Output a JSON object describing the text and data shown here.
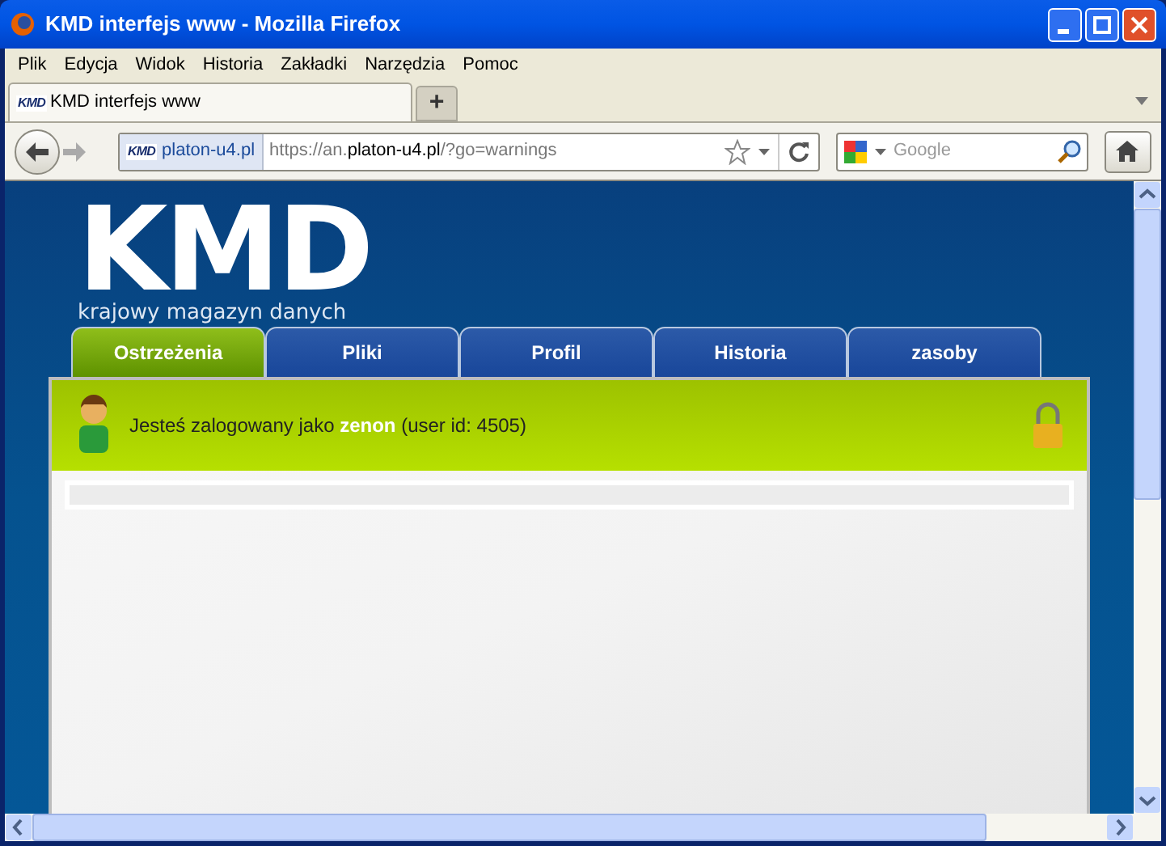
{
  "window": {
    "title": "KMD interfejs www - Mozilla Firefox"
  },
  "menu": [
    "Plik",
    "Edycja",
    "Widok",
    "Historia",
    "Zakładki",
    "Narzędzia",
    "Pomoc"
  ],
  "browser_tabs": [
    {
      "label": "KMD interfejs www",
      "favicon": "KMD",
      "selected": true
    }
  ],
  "new_tab": "+",
  "address": {
    "site": "platon-u4.pl",
    "favicon": "KMD",
    "url_prefix": "https://an.",
    "url_domain": "platon-u4.pl",
    "url_suffix": "/?go=warnings"
  },
  "search": {
    "placeholder": "Google"
  },
  "page": {
    "logo": "KMD",
    "tagline": "krajowy magazyn danych",
    "nav": [
      {
        "label": "Ostrzeżenia",
        "selected": true
      },
      {
        "label": "Pliki",
        "selected": false
      },
      {
        "label": "Profil",
        "selected": false
      },
      {
        "label": "Historia",
        "selected": false
      },
      {
        "label": "zasoby",
        "selected": false
      }
    ],
    "login": "Jesteś zalogowany jako **zenon** (user id: 4505)"
  }
}
